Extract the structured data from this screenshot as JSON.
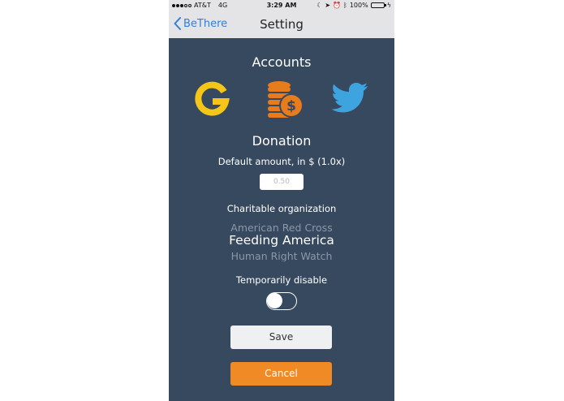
{
  "status_bar": {
    "carrier": "AT&T",
    "network": "4G",
    "time": "3:29 AM",
    "battery": "100%"
  },
  "nav": {
    "back_label": "BeThere",
    "title": "Setting"
  },
  "accounts": {
    "title": "Accounts",
    "icons": [
      "google-icon",
      "coins-icon",
      "twitter-icon"
    ]
  },
  "donation": {
    "title": "Donation",
    "amount_label": "Default amount, in $ (1.0x)",
    "amount_placeholder": "0.50",
    "org_label": "Charitable organization",
    "org_options": [
      "American Red Cross",
      "Feeding America",
      "Human Right Watch"
    ],
    "org_selected": "Feeding America"
  },
  "disable": {
    "label": "Temporarily disable",
    "enabled": false
  },
  "buttons": {
    "save": "Save",
    "cancel": "Cancel"
  },
  "colors": {
    "background": "#37495e",
    "nav_bar": "#e4e4e6",
    "link": "#2f7fdc",
    "google_yellow": "#f5c518",
    "coins_orange": "#e87b1c",
    "twitter_blue": "#3ea4e0",
    "cancel_orange": "#f08a24"
  }
}
